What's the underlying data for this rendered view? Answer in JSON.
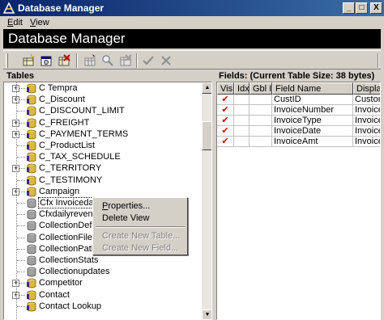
{
  "window": {
    "title": "Database Manager",
    "minimize": "_",
    "maximize": "□",
    "close": "X"
  },
  "menu": [
    {
      "label": "Edit",
      "mnemonic": "E",
      "rest": "dit"
    },
    {
      "label": "View",
      "mnemonic": "V",
      "rest": "iew"
    }
  ],
  "banner": {
    "title": "Database Manager"
  },
  "toolbar": {
    "buttons": [
      "new-table-icon",
      "table-properties-icon",
      "delete-table-icon",
      "new-field-icon",
      "find-icon",
      "delete-field-icon",
      "checkmark-icon",
      "cancel-x-icon"
    ]
  },
  "tables_pane": {
    "label": "Tables",
    "items": [
      {
        "label": "C Tempra",
        "expandable": true
      },
      {
        "label": "C_Discount",
        "expandable": true
      },
      {
        "label": "C_DISCOUNT_LIMIT",
        "expandable": false
      },
      {
        "label": "C_FREIGHT",
        "expandable": true
      },
      {
        "label": "C_PAYMENT_TERMS",
        "expandable": true
      },
      {
        "label": "C_ProductList",
        "expandable": false
      },
      {
        "label": "C_TAX_SCHEDULE",
        "expandable": false
      },
      {
        "label": "C_TERRITORY",
        "expandable": true
      },
      {
        "label": "C_TESTIMONY",
        "expandable": false
      },
      {
        "label": "Campaign",
        "expandable": true
      },
      {
        "label": "Cfx Invoicedata",
        "expandable": false,
        "selected": true
      },
      {
        "label": "Cfxdailyrevenue",
        "expandable": false
      },
      {
        "label": "CollectionDefs",
        "expandable": false
      },
      {
        "label": "CollectionFiles",
        "expandable": false
      },
      {
        "label": "CollectionPath",
        "expandable": false
      },
      {
        "label": "CollectionStats",
        "expandable": false
      },
      {
        "label": "Collectionupdates",
        "expandable": false
      },
      {
        "label": "Competitor",
        "expandable": true
      },
      {
        "label": "Contact",
        "expandable": true
      },
      {
        "label": "Contact Lookup",
        "expandable": false
      }
    ]
  },
  "context_menu": {
    "items": [
      {
        "label": "Properties...",
        "enabled": true
      },
      {
        "label": "Delete View",
        "enabled": true
      },
      {
        "label": "Create New Table...",
        "enabled": false
      },
      {
        "label": "Create New Field...",
        "enabled": false
      }
    ]
  },
  "fields_pane": {
    "label": "Fields: (Current Table Size: 38 bytes)",
    "columns": [
      "Vis",
      "Idx",
      "Gbl ID",
      "Field Name",
      "Display"
    ],
    "rows": [
      {
        "vis": "✔",
        "idx": "",
        "gbl": "",
        "name": "CustID",
        "display": "CustomerID"
      },
      {
        "vis": "✔",
        "idx": "",
        "gbl": "",
        "name": "InvoiceNumber",
        "display": "Invoice Number"
      },
      {
        "vis": "✔",
        "idx": "",
        "gbl": "",
        "name": "InvoiceType",
        "display": "Invoice Type"
      },
      {
        "vis": "✔",
        "idx": "",
        "gbl": "",
        "name": "InvoiceDate",
        "display": "Invoice Date"
      },
      {
        "vis": "✔",
        "idx": "",
        "gbl": "",
        "name": "InvoiceAmt",
        "display": "Invoice Amt"
      }
    ]
  }
}
